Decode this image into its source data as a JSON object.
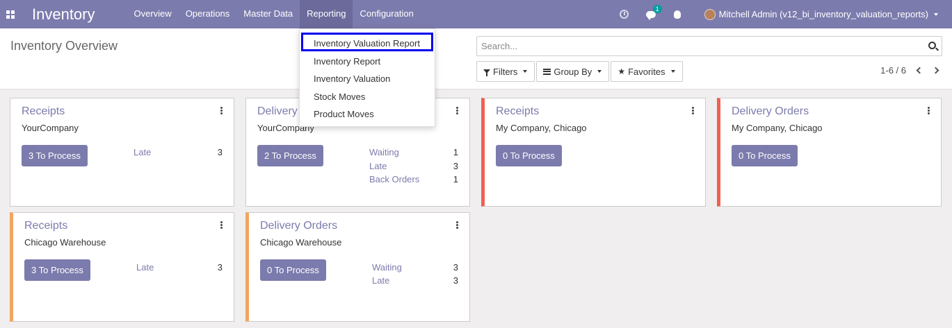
{
  "navbar": {
    "brand": "Inventory",
    "menu": [
      "Overview",
      "Operations",
      "Master Data",
      "Reporting",
      "Configuration"
    ],
    "active_menu": "Reporting",
    "messages_badge": "1",
    "user": "Mitchell Admin (v12_bi_inventory_valuation_reports)",
    "icons": [
      "apps-icon",
      "clock-icon",
      "chat-icon",
      "bug-icon",
      "avatar"
    ]
  },
  "reporting_menu": {
    "items": [
      "Inventory Valuation Report",
      "Inventory Report",
      "Inventory Valuation",
      "Stock Moves",
      "Product Moves"
    ],
    "highlighted": "Inventory Valuation Report"
  },
  "control_panel": {
    "title": "Inventory Overview",
    "search_placeholder": "Search...",
    "filters_label": "Filters",
    "group_by_label": "Group By",
    "favorites_label": "Favorites",
    "pager": "1-6 / 6"
  },
  "cards": [
    {
      "title": "Receipts",
      "company": "YourCompany",
      "button": "3 To Process",
      "stats": [
        {
          "label": "Late",
          "value": "3"
        }
      ],
      "color": "none"
    },
    {
      "title": "Delivery Orders",
      "company": "YourCompany",
      "button": "2 To Process",
      "stats": [
        {
          "label": "Waiting",
          "value": "1"
        },
        {
          "label": "Late",
          "value": "3"
        },
        {
          "label": "Back Orders",
          "value": "1"
        }
      ],
      "color": "none"
    },
    {
      "title": "Receipts",
      "company": "My Company, Chicago",
      "button": "0 To Process",
      "stats": [],
      "color": "#f06050"
    },
    {
      "title": "Delivery Orders",
      "company": "My Company, Chicago",
      "button": "0 To Process",
      "stats": [],
      "color": "#f06050"
    },
    {
      "title": "Receipts",
      "company": "Chicago Warehouse",
      "button": "3 To Process",
      "stats": [
        {
          "label": "Late",
          "value": "3"
        }
      ],
      "color": "#f4a460"
    },
    {
      "title": "Delivery Orders",
      "company": "Chicago Warehouse",
      "button": "0 To Process",
      "stats": [
        {
          "label": "Waiting",
          "value": "3"
        },
        {
          "label": "Late",
          "value": "3"
        }
      ],
      "color": "#f4a460"
    }
  ],
  "colors": {
    "brand": "#7c7bad",
    "highlight": "#0000ee"
  }
}
